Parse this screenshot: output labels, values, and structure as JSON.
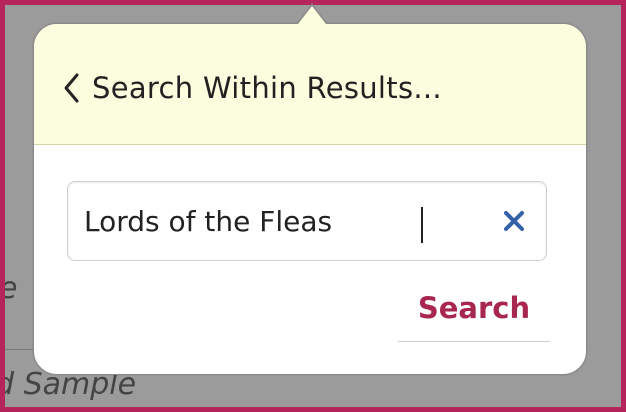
{
  "background": {
    "text_1": "e",
    "text_2": "d Sample"
  },
  "popover": {
    "header": {
      "back_label": "Search Within Results..."
    },
    "search": {
      "value": "Lords of the Fleas",
      "button_label": "Search"
    },
    "icons": {
      "back": "chevron-left-icon",
      "clear": "close-icon"
    }
  },
  "colors": {
    "outer_border": "#b5245a",
    "header_bg": "#fcfcde",
    "accent_text": "#a8274f",
    "clear_icon": "#3461a8"
  }
}
